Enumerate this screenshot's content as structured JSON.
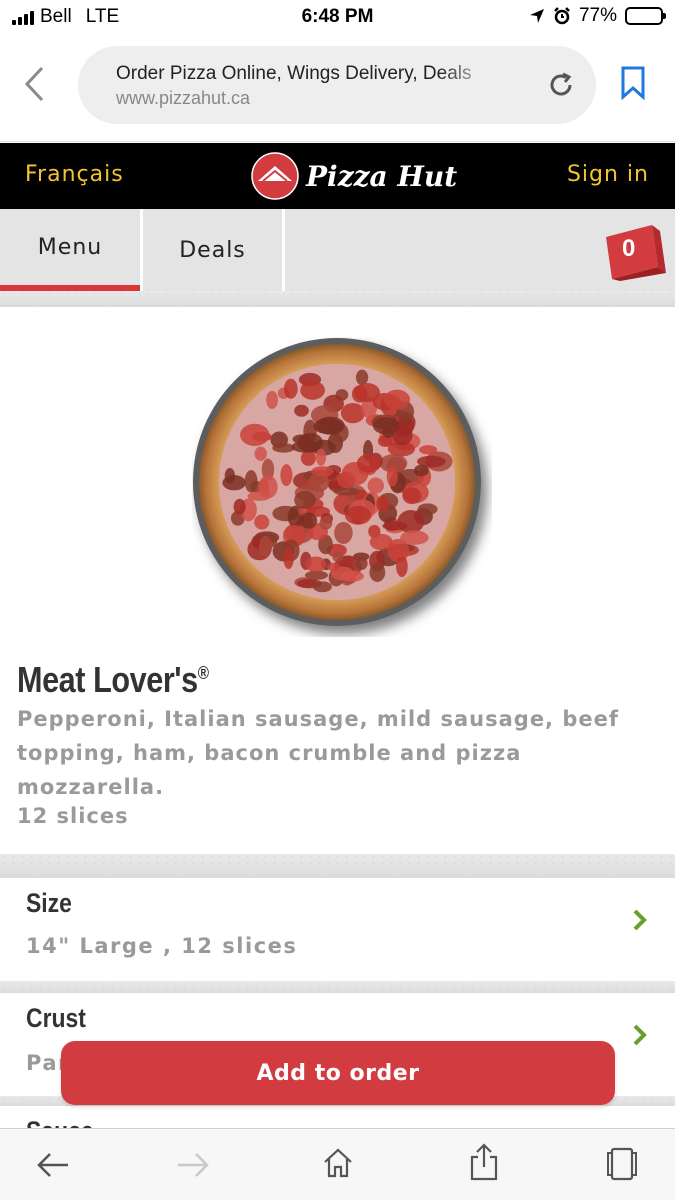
{
  "status_bar": {
    "carrier": "Bell",
    "network": "LTE",
    "time": "6:48 PM",
    "battery": "77%",
    "battery_level": 0.77
  },
  "address_bar": {
    "page_title": "Order Pizza Online, Wings Delivery, Deals",
    "url": "www.pizzahut.ca"
  },
  "header": {
    "language_link": "Français",
    "logo_text": "Pizza Hut",
    "sign_in": "Sign in"
  },
  "nav": {
    "tabs": [
      {
        "label": "Menu",
        "active": true
      },
      {
        "label": "Deals",
        "active": false
      }
    ],
    "cart_count": "0"
  },
  "product": {
    "name": "Meat Lover's",
    "registered_mark": "®",
    "description": "Pepperoni, Italian sausage, mild sausage, beef topping, ham, bacon crumble and pizza mozzarella.",
    "slices": "12 slices"
  },
  "options": {
    "size": {
      "label": "Size",
      "value": "14\" Large , 12 slices"
    },
    "crust": {
      "label": "Crust",
      "value": "Pan"
    },
    "sauce": {
      "label": "Sauce"
    }
  },
  "add_button": "Add to order",
  "colors": {
    "brand_red": "#d23b40",
    "gold": "#f4c430",
    "chevron_green": "#6a9e2a",
    "ios_blue": "#1f7ae0"
  }
}
